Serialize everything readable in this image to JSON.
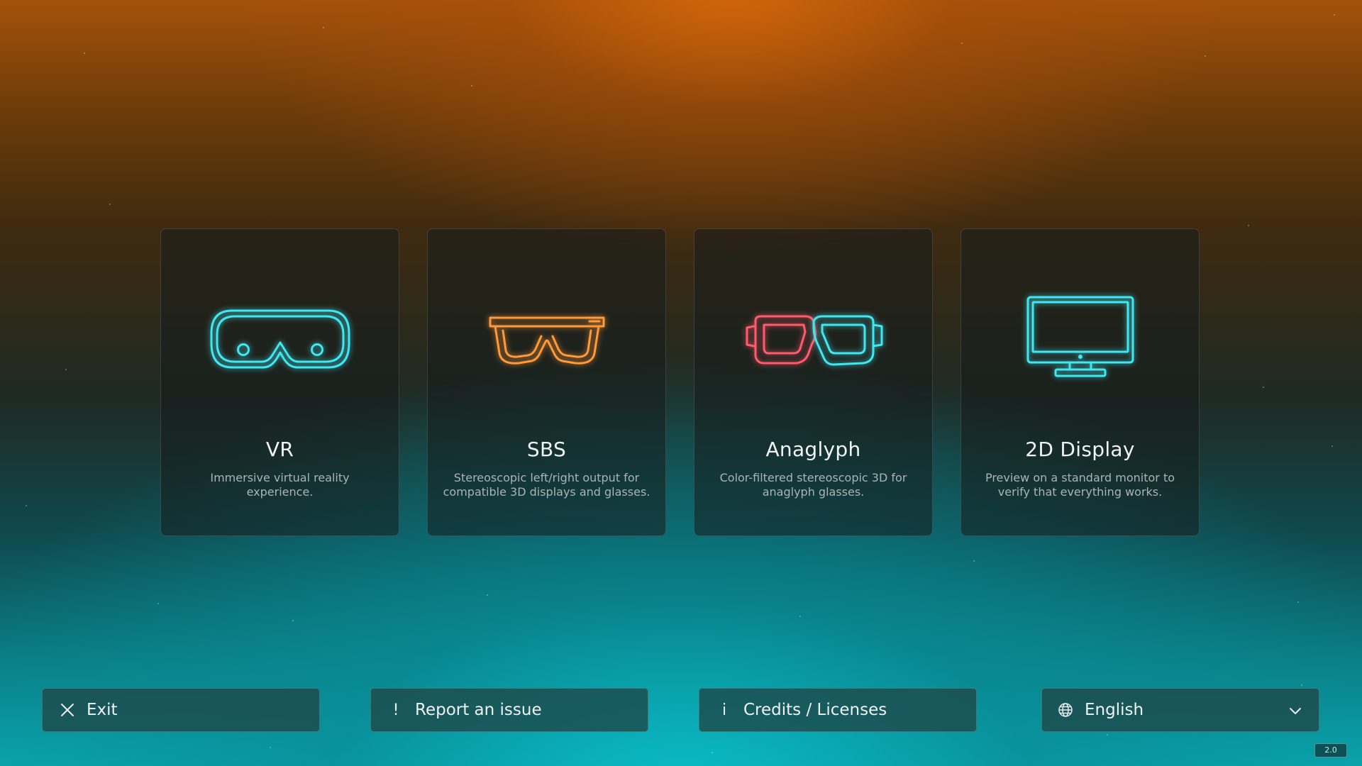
{
  "modes": [
    {
      "title": "VR",
      "description": "Immersive virtual reality experience.",
      "icon": "vr-headset-icon",
      "color": "#40e6f0"
    },
    {
      "title": "SBS",
      "description": "Stereoscopic left/right output for compatible 3D displays and glasses.",
      "icon": "3d-glasses-icon",
      "color": "#ff9a3c"
    },
    {
      "title": "Anaglyph",
      "description": "Color-filtered stereoscopic 3D for anaglyph glasses.",
      "icon": "anaglyph-glasses-icon",
      "colors": [
        "#ff5a6e",
        "#40e6f0"
      ]
    },
    {
      "title": "2D Display",
      "description": "Preview on a standard monitor to verify that everything works.",
      "icon": "monitor-icon",
      "color": "#40e6f0"
    }
  ],
  "bottom_bar": {
    "exit": {
      "label": "Exit",
      "icon": "close-icon"
    },
    "report": {
      "label": "Report an issue",
      "icon": "exclamation-icon",
      "glyph": "!"
    },
    "credits": {
      "label": "Credits / Licenses",
      "icon": "info-icon",
      "glyph": "i"
    },
    "language": {
      "selected": "English",
      "icon": "globe-icon"
    }
  },
  "version": "2.0"
}
